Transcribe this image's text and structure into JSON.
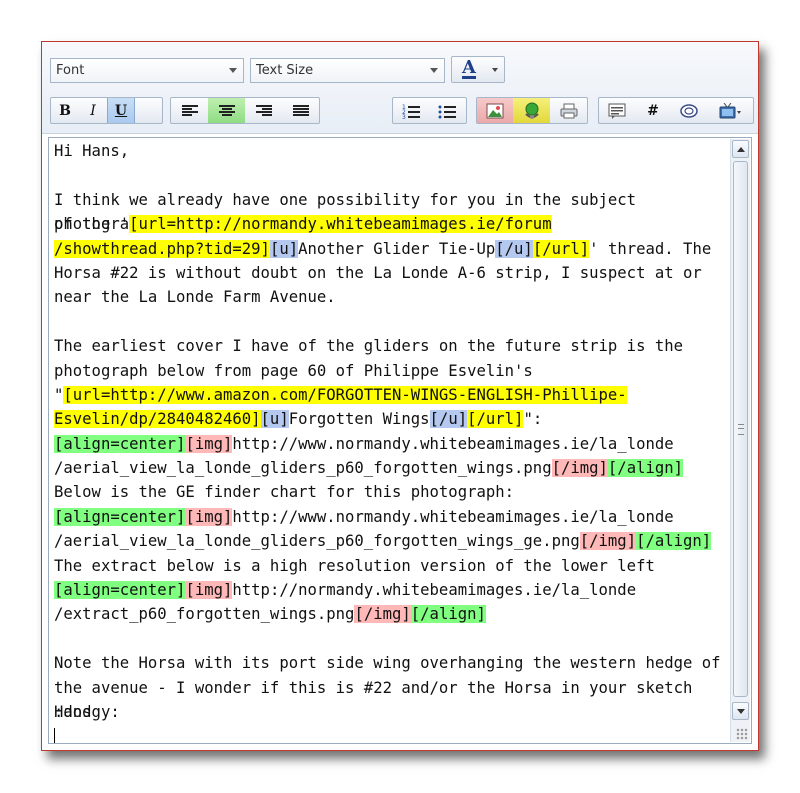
{
  "toolbar": {
    "font_select": "Font",
    "size_select": "Text Size",
    "color_label": "A",
    "bold": "B",
    "italic": "I",
    "underline": "U",
    "hash": "#"
  },
  "editor": {
    "lines": [
      [
        {
          "t": "Hi Hans,"
        }
      ],
      [
        {
          "t": ""
        }
      ],
      [
        {
          "t": "I think we already have one possibility for you in the subject photograph"
        }
      ],
      [
        {
          "t": "of the '"
        },
        {
          "t": "[url=http://normandy.whitebeamimages.ie/forum",
          "c": "y"
        }
      ],
      [
        {
          "t": "/showthread.php?tid=29]",
          "c": "y"
        },
        {
          "t": "[u]",
          "c": "b"
        },
        {
          "t": "Another Glider Tie-Up"
        },
        {
          "t": "[/u]",
          "c": "b"
        },
        {
          "t": "[/url]",
          "c": "y"
        },
        {
          "t": "' thread. The"
        }
      ],
      [
        {
          "t": "Horsa #22 is without doubt on the La Londe A-6 strip, I suspect at or"
        }
      ],
      [
        {
          "t": "near the La Londe Farm Avenue."
        }
      ],
      [
        {
          "t": ""
        }
      ],
      [
        {
          "t": "The earliest cover I have of the gliders on the future strip is the"
        }
      ],
      [
        {
          "t": "photograph below from page 60 of Philippe Esvelin's"
        }
      ],
      [
        {
          "t": "\""
        },
        {
          "t": "[url=http://www.amazon.com/FORGOTTEN-WINGS-ENGLISH-Phillipe-",
          "c": "y"
        }
      ],
      [
        {
          "t": "Esvelin/dp/2840482460]",
          "c": "y"
        },
        {
          "t": "[u]",
          "c": "b"
        },
        {
          "t": "Forgotten Wings"
        },
        {
          "t": "[/u]",
          "c": "b"
        },
        {
          "t": "[/url]",
          "c": "y"
        },
        {
          "t": "\":"
        }
      ],
      [
        {
          "t": "[align=center]",
          "c": "g"
        },
        {
          "t": "[img]",
          "c": "r"
        },
        {
          "t": "http://www.normandy.whitebeamimages.ie/la_londe"
        }
      ],
      [
        {
          "t": "/aerial_view_la_londe_gliders_p60_forgotten_wings.png"
        },
        {
          "t": "[/img]",
          "c": "r"
        },
        {
          "t": "[/align]",
          "c": "g"
        }
      ],
      [
        {
          "t": "Below is the GE finder chart for this photograph:"
        }
      ],
      [
        {
          "t": "[align=center]",
          "c": "g"
        },
        {
          "t": "[img]",
          "c": "r"
        },
        {
          "t": "http://www.normandy.whitebeamimages.ie/la_londe"
        }
      ],
      [
        {
          "t": "/aerial_view_la_londe_gliders_p60_forgotten_wings_ge.png"
        },
        {
          "t": "[/img]",
          "c": "r"
        },
        {
          "t": "[/align]",
          "c": "g"
        }
      ],
      [
        {
          "t": "The extract below is a high resolution version of the lower left corner:"
        }
      ],
      [
        {
          "t": "[align=center]",
          "c": "g"
        },
        {
          "t": "[img]",
          "c": "r"
        },
        {
          "t": "http://normandy.whitebeamimages.ie/la_londe"
        }
      ],
      [
        {
          "t": "/extract_p60_forgotten_wings.png"
        },
        {
          "t": "[/img]",
          "c": "r"
        },
        {
          "t": "[/align]",
          "c": "g"
        }
      ],
      [
        {
          "t": ""
        }
      ],
      [
        {
          "t": "Note the Horsa with its port side wing overhanging the western hedge of"
        }
      ],
      [
        {
          "t": "the avenue - I wonder if this is #22 and/or the Horsa in your sketch Hans"
        }
      ],
      [
        {
          "t": ":dodgy:"
        }
      ]
    ]
  },
  "colors": {
    "url_tag": "#ffff00",
    "underline_tag": "#b4c8f0",
    "align_tag": "#80ff80",
    "img_tag": "#ffb8b8",
    "frame_border": "#c0392b"
  }
}
